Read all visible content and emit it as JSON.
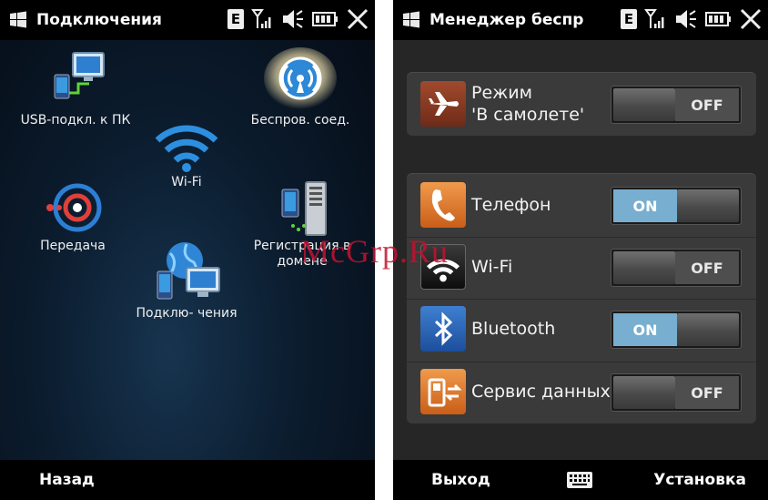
{
  "left_screen": {
    "title": "Подключения",
    "apps": [
      {
        "label": "USB-подкл. к ПК",
        "icon": "usb-pc-icon"
      },
      {
        "label": "Беспров. соед.",
        "icon": "wireless-manager-icon"
      },
      {
        "label": "Wi-Fi",
        "icon": "wifi-icon"
      },
      {
        "label": "Передача",
        "icon": "beam-icon"
      },
      {
        "label": "Регистрация в домене",
        "icon": "domain-enroll-icon"
      },
      {
        "label": "Подклю- чения",
        "icon": "connections-icon"
      }
    ],
    "softkey_left": "Назад"
  },
  "right_screen": {
    "title": "Менеджер беспр",
    "airplane": {
      "label_line1": "Режим",
      "label_line2": "'В самолете'",
      "state": "OFF"
    },
    "radios": [
      {
        "label": "Телефон",
        "state": "ON",
        "icon": "phone-icon"
      },
      {
        "label": "Wi-Fi",
        "state": "OFF",
        "icon": "wifi-icon"
      },
      {
        "label": "Bluetooth",
        "state": "ON",
        "icon": "bluetooth-icon"
      },
      {
        "label": "Сервис данных",
        "state": "OFF",
        "icon": "data-service-icon"
      }
    ],
    "softkey_left": "Выход",
    "softkey_right": "Установка"
  },
  "status_bar": {
    "network_letter": "E"
  },
  "watermark": "McGrp.Ru",
  "colors": {
    "on_toggle": "#78aecf",
    "airplane_icon_bg": "#8a3c24",
    "phone_icon_bg": "#e07a2a",
    "bluetooth_icon_bg": "#2a5fb0"
  }
}
